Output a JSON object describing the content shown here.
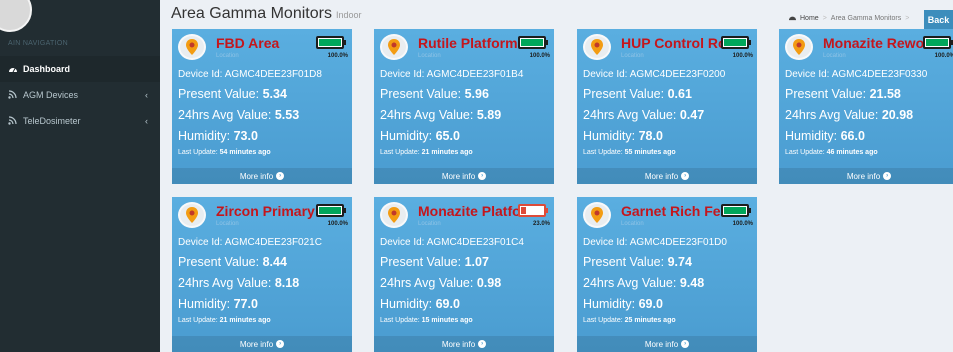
{
  "sidebar": {
    "nav_header": "AIN NAVIGATION",
    "items": [
      {
        "label": "Dashboard",
        "icon": "dashboard-icon",
        "active": true
      },
      {
        "label": "AGM Devices",
        "icon": "rss-icon",
        "chevron": "‹"
      },
      {
        "label": "TeleDosimeter",
        "icon": "rss-icon",
        "chevron": "‹"
      }
    ]
  },
  "header": {
    "title": "Area Gamma Monitors",
    "subtitle": "Indoor"
  },
  "breadcrumb": {
    "home": "Home",
    "current": "Area Gamma Monitors",
    "back": "Back"
  },
  "labels": {
    "device_id": "Device Id:",
    "present": "Present Value:",
    "avg": "24hrs Avg Value:",
    "humidity": "Humidity:",
    "last_update": "Last Update:",
    "more_info": "More info"
  },
  "colors": {
    "card": "#4a9cd0",
    "title_red": "#c4161c",
    "battery_ok": "#00a65a",
    "battery_low": "#dd4b39",
    "sidebar": "#222d32"
  },
  "cards": [
    {
      "name": "FBD Area",
      "sub": "Location",
      "battery": "100.0%",
      "battery_level": 1.0,
      "device_id": "AGMC4DEE23F01D8",
      "present": "5.34",
      "avg": "5.53",
      "humidity": "73.0",
      "updated": "54 minutes ago"
    },
    {
      "name": "Rutile Platform",
      "sub": "Location",
      "battery": "100.0%",
      "battery_level": 1.0,
      "device_id": "AGMC4DEE23F01B4",
      "present": "5.96",
      "avg": "5.89",
      "humidity": "65.0",
      "updated": "21 minutes ago"
    },
    {
      "name": "HUP Control Room",
      "sub": "Location",
      "battery": "100.0%",
      "battery_level": 1.0,
      "device_id": "AGMC4DEE23F0200",
      "present": "0.61",
      "avg": "0.47",
      "humidity": "78.0",
      "updated": "55 minutes ago"
    },
    {
      "name": "Monazite Rework",
      "sub": "Location",
      "battery": "100.0%",
      "battery_level": 1.0,
      "device_id": "AGMC4DEE23F0330",
      "present": "21.58",
      "avg": "20.98",
      "humidity": "66.0",
      "updated": "46 minutes ago"
    },
    {
      "name": "Zircon Primary",
      "sub": "Location",
      "battery": "100.0%",
      "battery_level": 1.0,
      "device_id": "AGMC4DEE23F021C",
      "present": "8.44",
      "avg": "8.18",
      "humidity": "77.0",
      "updated": "21 minutes ago"
    },
    {
      "name": "Monazite Platform",
      "sub": "Location",
      "battery": "23.0%",
      "battery_level": 0.23,
      "device_id": "AGMC4DEE23F01C4",
      "present": "1.07",
      "avg": "0.98",
      "humidity": "69.0",
      "updated": "15 minutes ago"
    },
    {
      "name": "Garnet Rich Feed",
      "sub": "Location",
      "battery": "100.0%",
      "battery_level": 1.0,
      "device_id": "AGMC4DEE23F01D0",
      "present": "9.74",
      "avg": "9.48",
      "humidity": "69.0",
      "updated": "25 minutes ago"
    }
  ]
}
